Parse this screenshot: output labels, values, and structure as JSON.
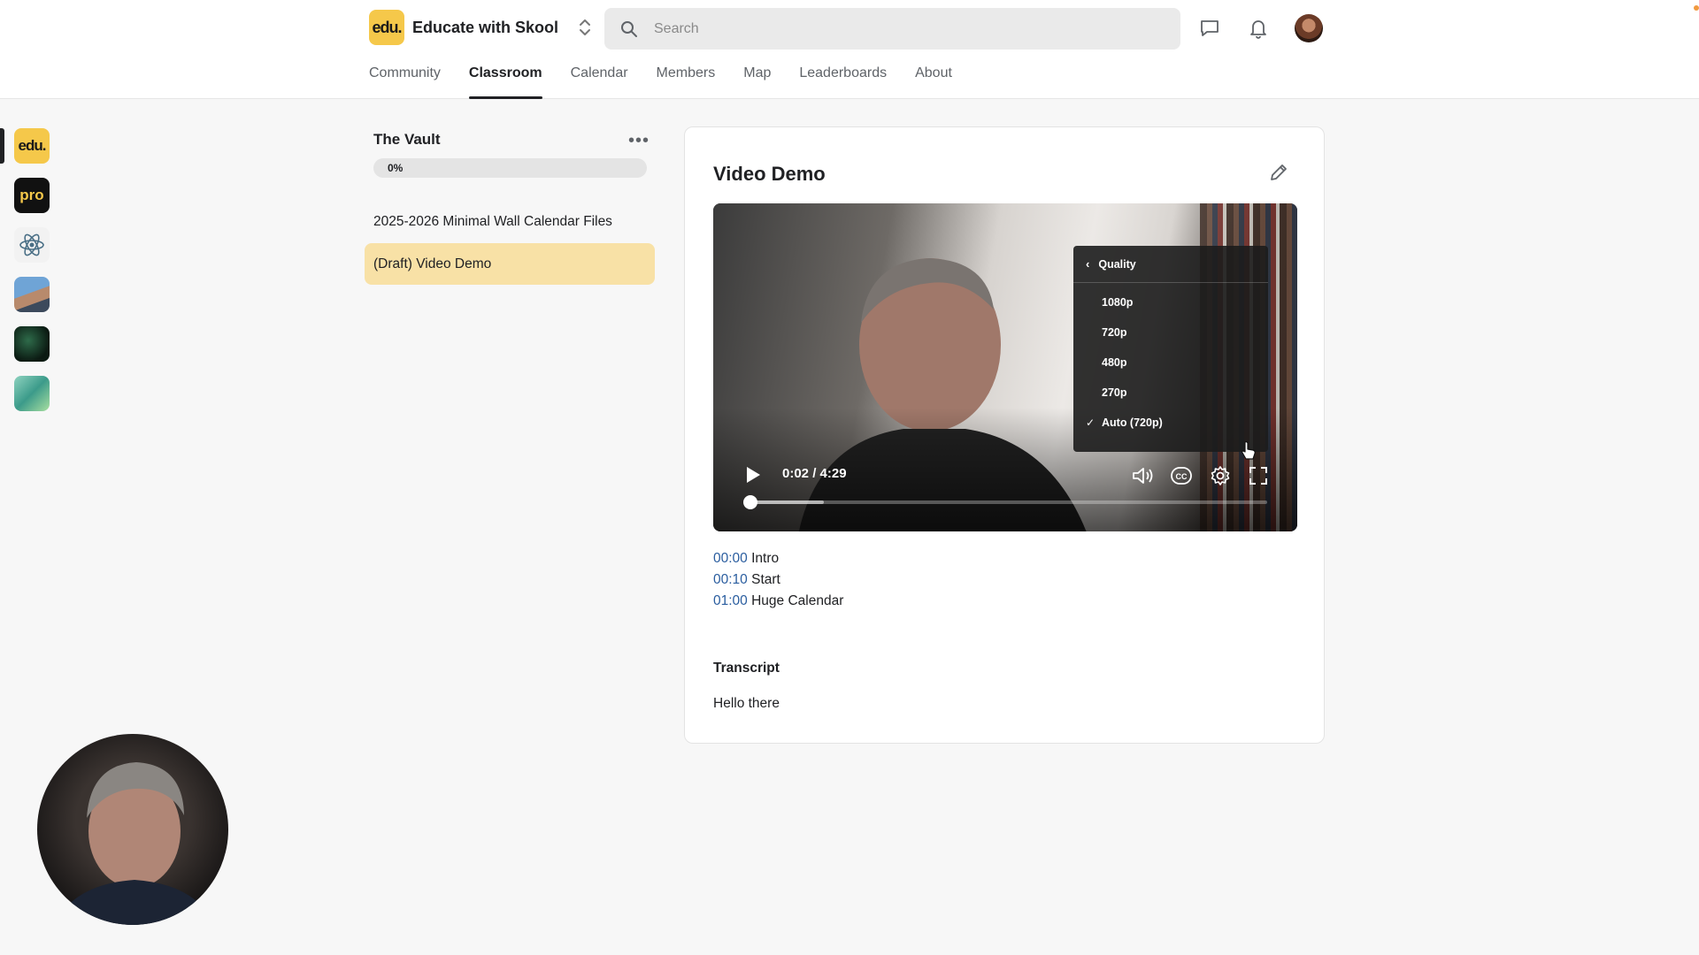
{
  "brand": {
    "logo_text": "edu.",
    "name": "Educate with Skool"
  },
  "search": {
    "placeholder": "Search"
  },
  "nav": {
    "tabs": [
      {
        "label": "Community"
      },
      {
        "label": "Classroom",
        "active": true
      },
      {
        "label": "Calendar"
      },
      {
        "label": "Members"
      },
      {
        "label": "Map"
      },
      {
        "label": "Leaderboards"
      },
      {
        "label": "About"
      }
    ]
  },
  "rail": {
    "items": [
      {
        "label": "edu.",
        "icon": "edu-community-logo"
      },
      {
        "label": "pro",
        "icon": "pro-community-logo"
      },
      {
        "icon": "atom-community-logo"
      },
      {
        "icon": "person-community-avatar"
      },
      {
        "icon": "inspire-growth-community-logo"
      },
      {
        "icon": "grow-community-logo"
      }
    ]
  },
  "course": {
    "title": "The Vault",
    "progress_label": "0%",
    "progress": 0,
    "lessons": [
      {
        "label": "2025-2026 Minimal Wall Calendar Files"
      },
      {
        "label": "(Draft) Video Demo",
        "active": true
      }
    ]
  },
  "lesson": {
    "title": "Video Demo",
    "player": {
      "time": "0:02 / 4:29",
      "played_fraction": 0.007,
      "buffered_fraction": 0.15,
      "quality_menu": {
        "title": "Quality",
        "options": [
          "1080p",
          "720p",
          "480p",
          "270p",
          "Auto (720p)"
        ],
        "selected": "Auto (720p)"
      }
    },
    "chapters": [
      {
        "time": "00:00",
        "label": "Intro"
      },
      {
        "time": "00:10",
        "label": "Start"
      },
      {
        "time": "01:00",
        "label": "Huge Calendar"
      }
    ],
    "transcript_heading": "Transcript",
    "transcript_text": "Hello there"
  },
  "colors": {
    "accent": "#f5c84a",
    "active_lesson": "#f8e1a6",
    "chapter_link": "#2a5d9f"
  }
}
